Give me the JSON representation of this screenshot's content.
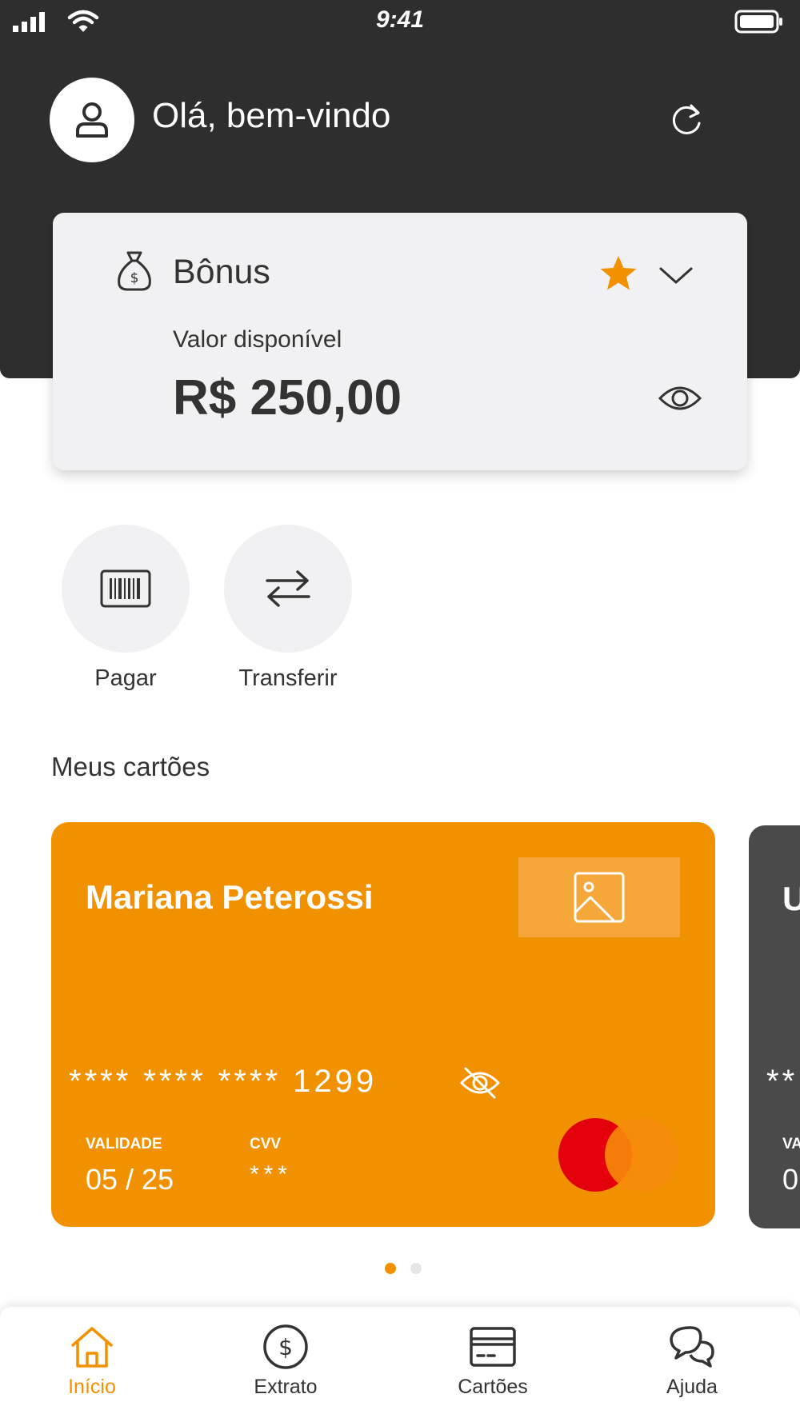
{
  "status_bar": {
    "time": "9:41"
  },
  "header": {
    "greeting": "Olá, bem-vindo"
  },
  "balance": {
    "title": "Bônus",
    "available_label": "Valor disponível",
    "amount": "R$ 250,00",
    "favorite": true
  },
  "actions": [
    {
      "label": "Pagar",
      "icon": "barcode-icon"
    },
    {
      "label": "Transferir",
      "icon": "transfer-icon"
    }
  ],
  "cards_section": {
    "title": "Meus cartões"
  },
  "cards": [
    {
      "holder": "Mariana Peterossi",
      "number_masked": "**** **** **** 1299",
      "validity_label": "VALIDADE",
      "validity": "05 / 25",
      "cvv_label": "CVV",
      "cvv": "***",
      "brand": "mastercard",
      "color": "#f29100"
    },
    {
      "holder_partial": "U",
      "number_partial": "**",
      "validity_label_partial": "VA",
      "validity_partial": "0",
      "color": "#4a4a4a"
    }
  ],
  "carousel": {
    "active_index": 0,
    "count": 2
  },
  "bottom_nav": {
    "active": "Início",
    "items": [
      {
        "label": "Início",
        "icon": "home-icon"
      },
      {
        "label": "Extrato",
        "icon": "dollar-circle-icon"
      },
      {
        "label": "Cartões",
        "icon": "card-icon"
      },
      {
        "label": "Ajuda",
        "icon": "chat-bubbles-icon"
      }
    ]
  },
  "colors": {
    "accent": "#f29100",
    "header_bg": "#2e2e2e",
    "card_surface": "#f1f1f3"
  }
}
